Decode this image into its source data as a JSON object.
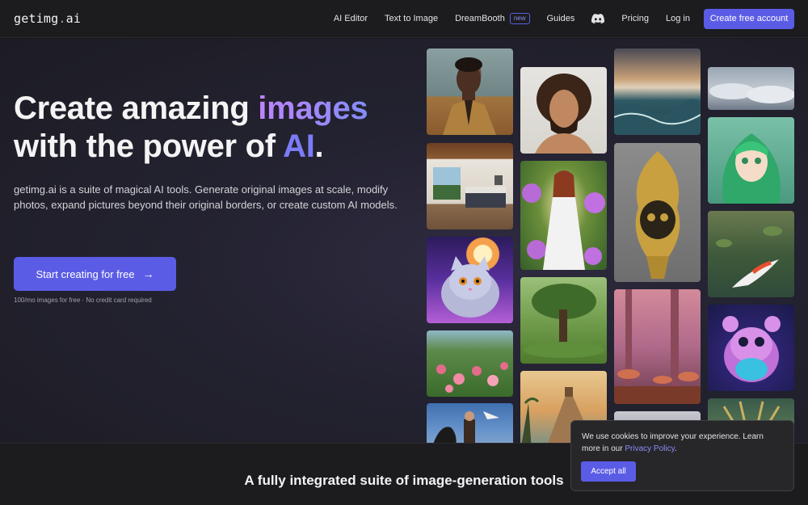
{
  "nav": {
    "logo_main": "getimg",
    "logo_dot": ".",
    "logo_tld": "ai",
    "links": [
      "AI Editor",
      "Text to Image",
      "DreamBooth",
      "Guides"
    ],
    "dreambooth_badge": "new",
    "discord_icon": "discord-icon",
    "pricing": "Pricing",
    "login": "Log in",
    "create_account": "Create free account"
  },
  "hero": {
    "title_part1": "Create amazing ",
    "title_highlight1": "images",
    "title_part2": "with the power of ",
    "title_highlight2": "AI",
    "title_end": ".",
    "description": "getimg.ai is a suite of magical AI tools. Generate original images at scale, modify photos, expand pictures beyond their original borders, or create custom AI models.",
    "cta_label": "Start creating for free",
    "cta_icon": "arrow-right-icon",
    "cta_note": "100/mo images for free · No credit card required"
  },
  "section": {
    "title": "A fully integrated suite of image-generation tools"
  },
  "cookie": {
    "text": "We use cookies to improve your experience. Learn more in our ",
    "link": "Privacy Policy",
    "end": ".",
    "accept": "Accept all"
  },
  "colors": {
    "accent": "#5b5ce6",
    "background": "#18181b",
    "highlight_gradient_start": "#c084fc",
    "highlight_gradient_end": "#818cf8"
  }
}
